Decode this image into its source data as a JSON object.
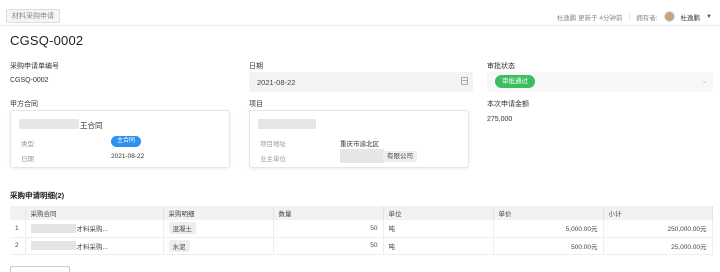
{
  "header": {
    "tag": "材料采购申请",
    "owner_info": "杜逸鹏 更新于 4分钟前",
    "owner_label": "拥有者:",
    "owner_name": "杜逸鹏"
  },
  "title": "CGSQ-0002",
  "fields": {
    "code_label": "采购申请单编号",
    "code_value": "CGSQ-0002",
    "date_label": "日期",
    "date_value": "2021-08-22",
    "status_label": "审批状态",
    "status_value": "审批通过",
    "contract_label": "甲方合同",
    "project_label": "项目",
    "amount_label": "本次申请金额",
    "amount_value": "275,000"
  },
  "contract_card": {
    "title_suffix": "王合同",
    "type_label": "类型",
    "type_value": "主合同",
    "date_label": "日期",
    "date_value": "2021-08-22"
  },
  "project_card": {
    "address_label": "项目地址",
    "address_value": "重庆市渝北区",
    "owner_label": "业主单位",
    "owner_value_suffix": "有限公司"
  },
  "details": {
    "title": "采购申请明细(2)",
    "columns": [
      "",
      "采购合同",
      "采购明细",
      "数量",
      "单位",
      "单价",
      "小计"
    ],
    "rows": [
      {
        "index": "1",
        "contract_suffix": "才料采购...",
        "material": "混凝土",
        "qty": "50",
        "unit": "吨",
        "price": "5,000.00元",
        "subtotal": "250,000.00元"
      },
      {
        "index": "2",
        "contract_suffix": "才料采购...",
        "material": "水泥",
        "qty": "50",
        "unit": "吨",
        "price": "500.00元",
        "subtotal": "25,000.00元"
      }
    ]
  },
  "colors": {
    "status_green": "#3cbd5e",
    "pill_blue": "#2f8ff0"
  }
}
